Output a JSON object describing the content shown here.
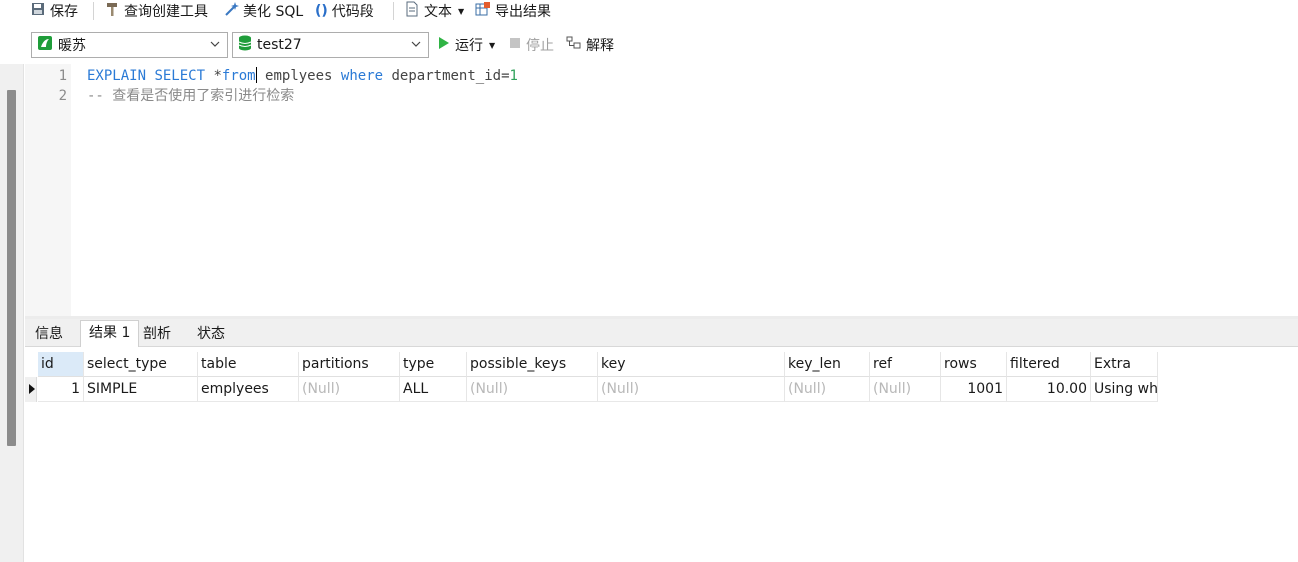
{
  "toolbar": {
    "save": "保存",
    "query_builder": "查询创建工具",
    "beautify_sql": "美化 SQL",
    "code_snippet": "代码段",
    "text": "文本",
    "export_results": "导出结果"
  },
  "connection": {
    "value": "暖苏"
  },
  "database": {
    "value": "test27"
  },
  "actions": {
    "run": "运行",
    "stop": "停止",
    "explain": "解释"
  },
  "editor": {
    "lines": [
      {
        "number": "1",
        "tokens": [
          "EXPLAIN",
          " ",
          "SELECT",
          " *",
          "from",
          " emplyees ",
          "where",
          " department_id=",
          "1"
        ]
      },
      {
        "number": "2",
        "comment": "-- 查看是否使用了索引进行检索"
      }
    ]
  },
  "result_tabs": [
    "信息",
    "结果 1",
    "剖析",
    "状态"
  ],
  "grid": {
    "columns": [
      "id",
      "select_type",
      "table",
      "partitions",
      "type",
      "possible_keys",
      "key",
      "key_len",
      "ref",
      "rows",
      "filtered",
      "Extra"
    ],
    "rows": [
      [
        "1",
        "SIMPLE",
        "emplyees",
        "(Null)",
        "ALL",
        "(Null)",
        "(Null)",
        "(Null)",
        "(Null)",
        "1001",
        "10.00",
        "Using where"
      ]
    ]
  },
  "colors": {
    "keyword": "#2a7ad6",
    "number": "#2fa15a",
    "comment": "#8a8a8a",
    "run_green": "#2fb344",
    "db_green": "#1f9d3a"
  }
}
